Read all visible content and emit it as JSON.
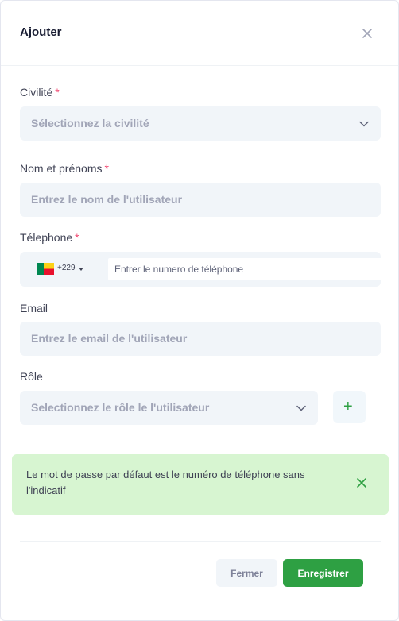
{
  "modal": {
    "title": "Ajouter"
  },
  "form": {
    "civilite": {
      "label": "Civilité",
      "required_mark": "*",
      "placeholder": "Sélectionnez la civilité"
    },
    "nom": {
      "label": "Nom et prénoms",
      "required_mark": "*",
      "placeholder": "Entrez le nom de l'utilisateur"
    },
    "telephone": {
      "label": "Télephone",
      "required_mark": "*",
      "dial_code": "+229",
      "country_flag": "benin-flag-icon",
      "placeholder": "Entrer le numero de téléphone",
      "value": ""
    },
    "email": {
      "label": "Email",
      "placeholder": "Entrez le email de l'utilisateur"
    },
    "role": {
      "label": "Rôle",
      "placeholder": "Selectionnez le rôle le l'utilisateur",
      "add_label": "+"
    }
  },
  "alert": {
    "text": "Le mot de passe par défaut est le numéro de téléphone sans l'indicatif"
  },
  "footer": {
    "cancel_label": "Fermer",
    "save_label": "Enregistrer"
  },
  "colors": {
    "primary": "#2ea043",
    "required": "#f1416c",
    "alert_bg": "#d7f5d1",
    "field_bg": "#f1f5f9"
  }
}
